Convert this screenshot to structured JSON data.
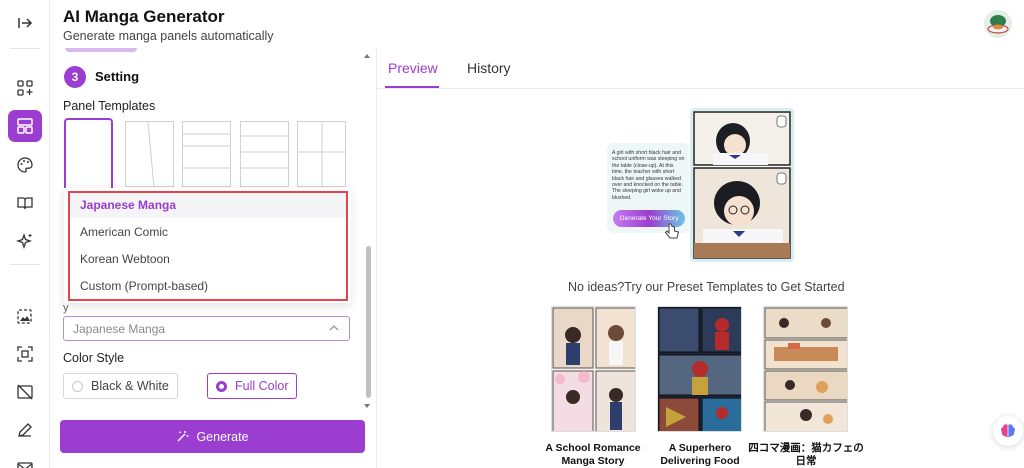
{
  "header": {
    "title": "AI Manga Generator",
    "subtitle": "Generate manga panels automatically"
  },
  "rail": {
    "items": [
      {
        "icon": "collapse-sidebar-icon"
      },
      {
        "icon": "add-grid-icon"
      },
      {
        "icon": "layout-panels-icon",
        "active": true
      },
      {
        "icon": "palette-icon"
      },
      {
        "icon": "book-icon"
      },
      {
        "icon": "sparkle-icon"
      },
      {
        "icon": "image-edit-icon"
      },
      {
        "icon": "focus-frame-icon"
      },
      {
        "icon": "image-off-icon"
      },
      {
        "icon": "pencil-icon"
      },
      {
        "icon": "mail-icon"
      }
    ]
  },
  "settings": {
    "step_number": "3",
    "step_title": "Setting",
    "panel_templates_label": "Panel Templates",
    "style_select_value": "Japanese Manga",
    "style_options": [
      "Japanese Manga",
      "American Comic",
      "Korean Webtoon",
      "Custom (Prompt-based)"
    ],
    "selected_style": "Japanese Manga",
    "color_style_label": "Color Style",
    "color_options": [
      "Black & White",
      "Full Color"
    ],
    "selected_color": "Full Color",
    "generate_label": "Generate"
  },
  "tabs": {
    "preview": "Preview",
    "history": "History",
    "active": "Preview"
  },
  "preview": {
    "promo_text": "A girl with short black hair and school uniform was sleeping on the table (close-up). At this time, the teacher with short black hair and glasses walked over and knocked on the table. The sleeping girl woke up and blushed.",
    "promo_button": "Generate Your Story",
    "no_ideas_text": "No ideas?Try our Preset Templates to Get Started",
    "presets": [
      {
        "title": "A School Romance Manga Story"
      },
      {
        "title": "A Superhero Delivering Food"
      },
      {
        "title": "四コマ漫画：猫カフェの日常"
      }
    ]
  },
  "colors": {
    "accent": "#9b3dd0",
    "highlight_outline": "#e0474c"
  }
}
